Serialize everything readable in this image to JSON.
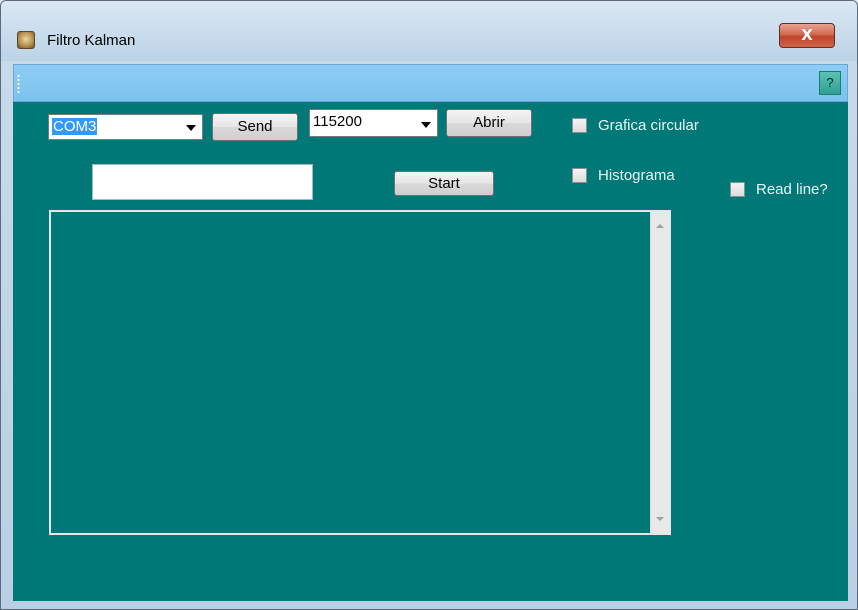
{
  "window": {
    "title": "Filtro Kalman",
    "close_glyph": "X",
    "help_label": "?"
  },
  "serial": {
    "port_value": "COM3",
    "baud_value": "115200",
    "send_label": "Send",
    "open_label": "Abrir",
    "start_label": "Start",
    "command_value": ""
  },
  "options": {
    "circular_label": "Grafica circular",
    "histogram_label": "Histograma",
    "readline_label": "Read line?"
  },
  "output": {
    "text": ""
  },
  "colors": {
    "client_bg": "#007878",
    "toolstrip_bg": "#7cc2ef",
    "close_button": "#c0432a"
  },
  "icons": {
    "app": "app-logo-icon",
    "close": "close-icon",
    "dropdown": "chevron-down-icon"
  }
}
